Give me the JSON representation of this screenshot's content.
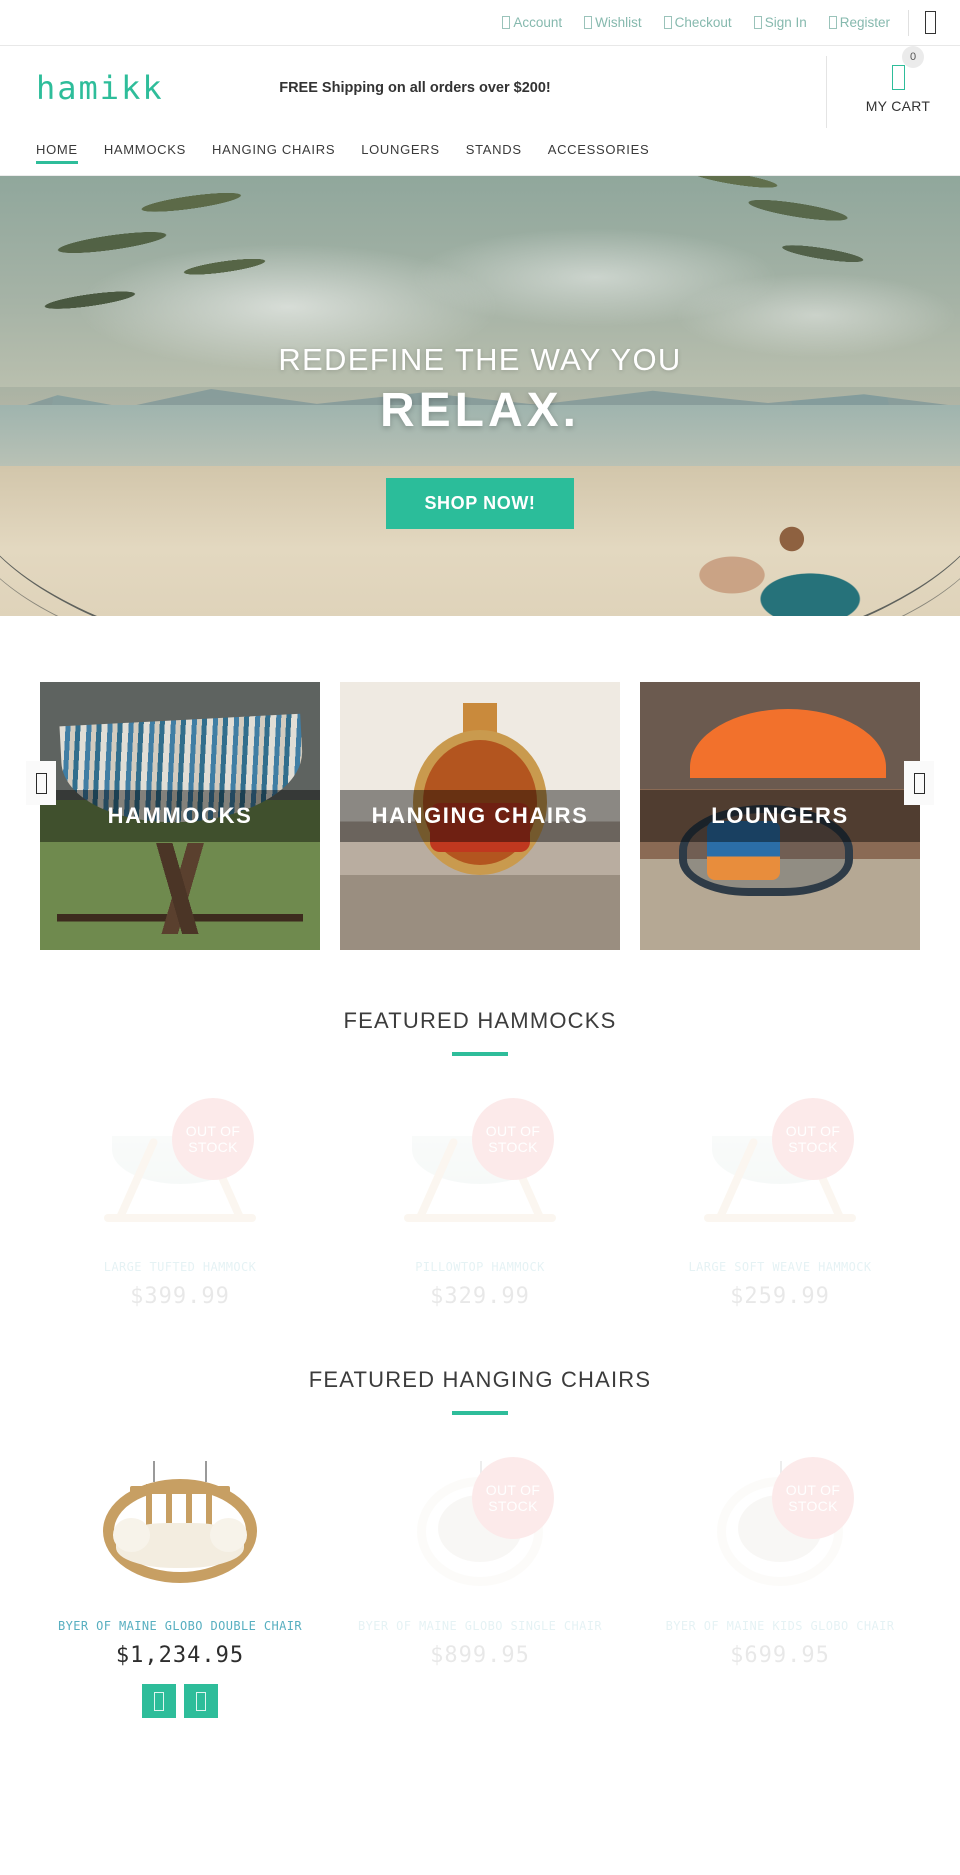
{
  "topbar": {
    "links": [
      {
        "label": "Account",
        "icon": "user-icon"
      },
      {
        "label": "Wishlist",
        "icon": "heart-icon"
      },
      {
        "label": "Checkout",
        "icon": "bag-icon"
      },
      {
        "label": "Sign In",
        "icon": "signin-icon"
      },
      {
        "label": "Register",
        "icon": "register-icon"
      }
    ],
    "search_icon": "search-icon"
  },
  "header": {
    "logo": "hamikk",
    "shipping_message": "FREE Shipping on all orders over $200!",
    "cart": {
      "count": "0",
      "label": "MY CART",
      "icon": "cart-icon"
    }
  },
  "nav": {
    "items": [
      {
        "label": "HOME",
        "active": true
      },
      {
        "label": "HAMMOCKS",
        "active": false
      },
      {
        "label": "HANGING CHAIRS",
        "active": false
      },
      {
        "label": "LOUNGERS",
        "active": false
      },
      {
        "label": "STANDS",
        "active": false
      },
      {
        "label": "ACCESSORIES",
        "active": false
      }
    ]
  },
  "hero": {
    "headline_line1": "REDEFINE THE WAY YOU",
    "headline_line2": "RELAX.",
    "cta_label": "SHOP NOW!",
    "cta_color": "#2bbd9a"
  },
  "categories": {
    "prev_icon": "chevron-left-icon",
    "next_icon": "chevron-right-icon",
    "tiles": [
      {
        "label": "HAMMOCKS"
      },
      {
        "label": "HANGING CHAIRS"
      },
      {
        "label": "LOUNGERS"
      }
    ]
  },
  "sections": [
    {
      "title": "FEATURED HAMMOCKS",
      "accent": "#2ebd9a",
      "products": [
        {
          "name": "LARGE TUFTED HAMMOCK",
          "price": "$399.99",
          "in_stock": false,
          "badge_line1": "OUT OF",
          "badge_line2": "STOCK"
        },
        {
          "name": "PILLOWTOP HAMMOCK",
          "price": "$329.99",
          "in_stock": false,
          "badge_line1": "OUT OF",
          "badge_line2": "STOCK"
        },
        {
          "name": "LARGE SOFT WEAVE HAMMOCK",
          "price": "$259.99",
          "in_stock": false,
          "badge_line1": "OUT OF",
          "badge_line2": "STOCK"
        }
      ]
    },
    {
      "title": "FEATURED HANGING CHAIRS",
      "accent": "#2ebd9a",
      "products": [
        {
          "name": "BYER OF MAINE GLOBO DOUBLE CHAIR",
          "price": "$1,234.95",
          "in_stock": true,
          "actions": [
            {
              "icon": "add-to-cart-icon"
            },
            {
              "icon": "add-to-wishlist-icon"
            }
          ]
        },
        {
          "name": "BYER OF MAINE GLOBO SINGLE CHAIR",
          "price": "$899.95",
          "in_stock": false,
          "badge_line1": "OUT OF",
          "badge_line2": "STOCK"
        },
        {
          "name": "BYER OF MAINE KIDS GLOBO CHAIR",
          "price": "$699.95",
          "in_stock": false,
          "badge_line1": "OUT OF",
          "badge_line2": "STOCK"
        }
      ]
    }
  ],
  "theme": {
    "accent_teal": "#2ebd9a",
    "link_teal": "#86b9ae",
    "oos_badge": "#f08a8a",
    "product_name": "#68b6c4"
  }
}
